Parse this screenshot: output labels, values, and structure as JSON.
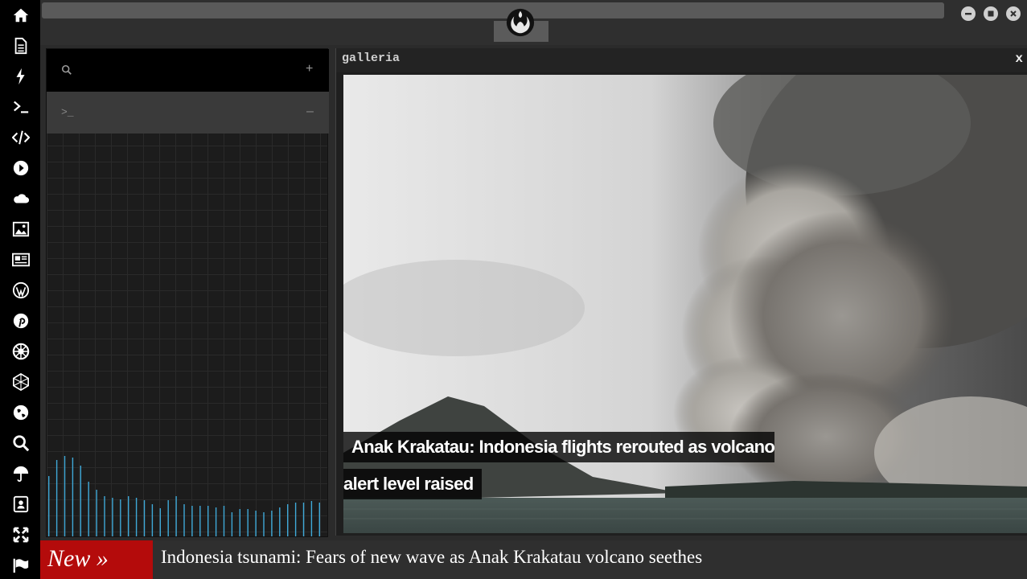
{
  "rail": {
    "icons": [
      "home-icon",
      "document-icon",
      "lightning-icon",
      "terminal-icon",
      "code-icon",
      "play-icon",
      "cloud-icon",
      "image-icon",
      "newspaper-icon",
      "wordpress-icon",
      "pinterest-icon",
      "empire-icon",
      "hexagon-icon",
      "globe-icon",
      "search-icon",
      "umbrella-icon",
      "contact-book-icon",
      "expand-icon",
      "flag-icon"
    ]
  },
  "topbar": {
    "emblem": "rebel-alliance-icon",
    "window_buttons": [
      "minimize-icon",
      "maximize-icon",
      "close-icon"
    ]
  },
  "leftpanel": {
    "search_icon": "search-icon",
    "search_action": "+",
    "terminal_prompt": ">_",
    "terminal_action": "–"
  },
  "gallery": {
    "title": "galleria",
    "close": "x",
    "caption_line1": "Anak Krakatau: Indonesia flights rerouted as volcano",
    "caption_line2": "alert level raised"
  },
  "ticker": {
    "badge": "New »",
    "headline": "Indonesia tsunami: Fears of new wave as Anak Krakatau volcano seethes"
  },
  "colors": {
    "rail": "#000000",
    "badge": "#b40b0b",
    "bars": "#3fa9d8"
  }
}
